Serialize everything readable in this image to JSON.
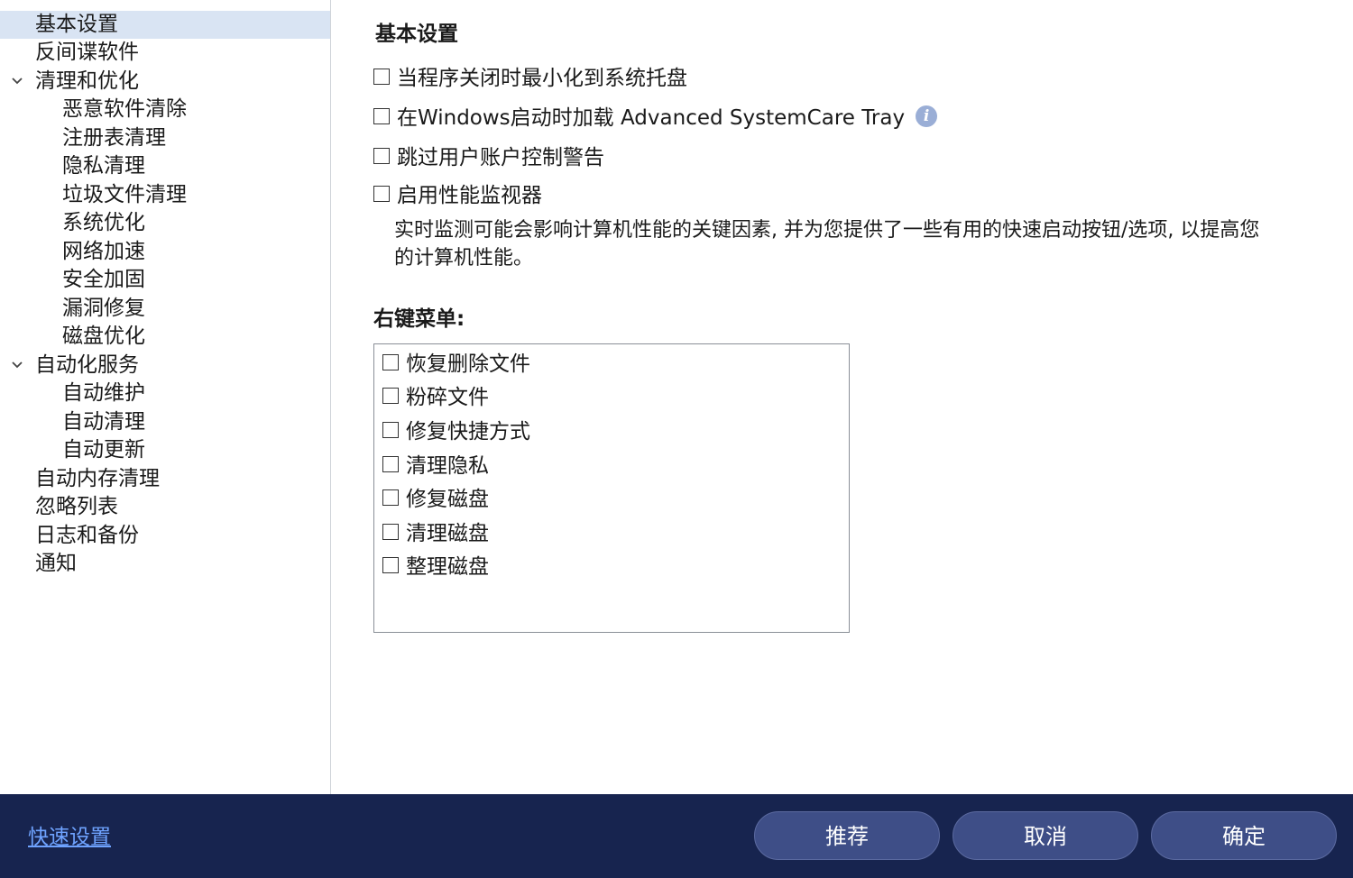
{
  "sidebar": {
    "items": [
      {
        "label": "基本设置",
        "level": 0,
        "selected": true
      },
      {
        "label": "反间谍软件",
        "level": 0
      },
      {
        "label": "清理和优化",
        "level": 0,
        "expanded": true
      },
      {
        "label": "恶意软件清除",
        "level": 1
      },
      {
        "label": "注册表清理",
        "level": 1
      },
      {
        "label": "隐私清理",
        "level": 1
      },
      {
        "label": "垃圾文件清理",
        "level": 1
      },
      {
        "label": "系统优化",
        "level": 1
      },
      {
        "label": "网络加速",
        "level": 1
      },
      {
        "label": "安全加固",
        "level": 1
      },
      {
        "label": "漏洞修复",
        "level": 1
      },
      {
        "label": "磁盘优化",
        "level": 1
      },
      {
        "label": "自动化服务",
        "level": 0,
        "expanded": true
      },
      {
        "label": "自动维护",
        "level": 1
      },
      {
        "label": "自动清理",
        "level": 1
      },
      {
        "label": "自动更新",
        "level": 1
      },
      {
        "label": "自动内存清理",
        "level": 0
      },
      {
        "label": "忽略列表",
        "level": 0
      },
      {
        "label": "日志和备份",
        "level": 0
      },
      {
        "label": "通知",
        "level": 0
      }
    ]
  },
  "main": {
    "title": "基本设置",
    "options": {
      "minimize_to_tray": {
        "label": "当程序关闭时最小化到系统托盘",
        "checked": false
      },
      "load_tray": {
        "label": "在Windows启动时加载 Advanced SystemCare Tray",
        "checked": false
      },
      "skip_uac": {
        "label": "跳过用户账户控制警告",
        "checked": false
      },
      "perf_monitor": {
        "label": "启用性能监视器",
        "checked": false
      }
    },
    "perf_monitor_description": "实时监测可能会影响计算机性能的关键因素, 并为您提供了一些有用的快速启动按钮/选项, 以提高您的计算机性能。",
    "context_menu": {
      "title": "右键菜单:",
      "items": [
        {
          "label": "恢复删除文件",
          "checked": false
        },
        {
          "label": "粉碎文件",
          "checked": false
        },
        {
          "label": "修复快捷方式",
          "checked": false
        },
        {
          "label": "清理隐私",
          "checked": false
        },
        {
          "label": "修复磁盘",
          "checked": false
        },
        {
          "label": "清理磁盘",
          "checked": false
        },
        {
          "label": "整理磁盘",
          "checked": false
        }
      ]
    }
  },
  "footer": {
    "quick_settings": "快速设置",
    "recommend": "推荐",
    "cancel": "取消",
    "ok": "确定"
  },
  "colors": {
    "footer_bg": "#17244f",
    "button_bg": "#3e4e87",
    "link": "#6fa3ff",
    "selected_bg": "#d9e4f3",
    "info_icon": "#9aaed6"
  }
}
